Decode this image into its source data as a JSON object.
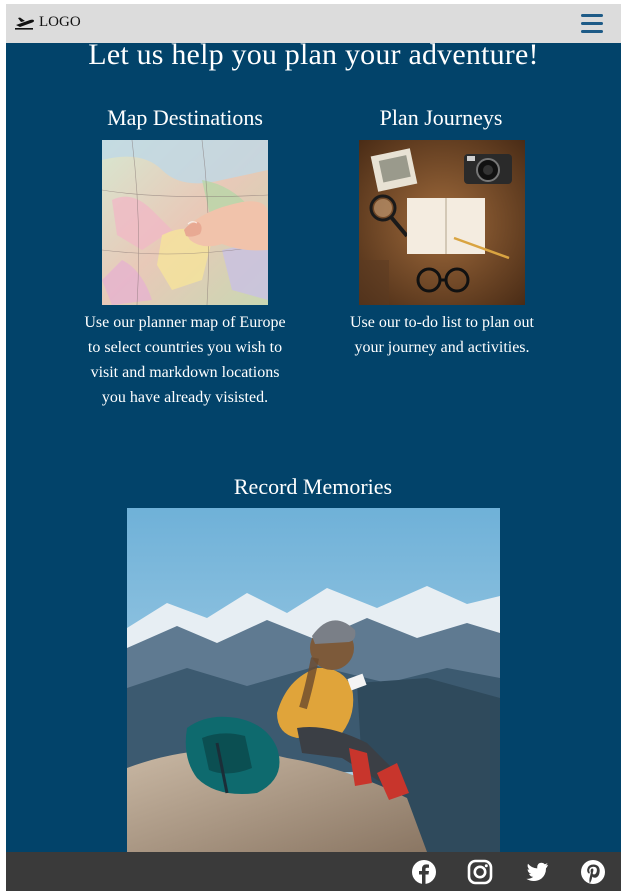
{
  "header": {
    "logo_text": "LOGO",
    "logo_icon": "plane-icon",
    "menu_icon": "hamburger-menu-icon"
  },
  "main": {
    "headline": "Let us help you plan your adventure!",
    "cards": [
      {
        "title": "Map Destinations",
        "image": "map-pointing-photo",
        "text": "Use our planner map of Europe to select countries you wish to visit and markdown locations you have already visisted."
      },
      {
        "title": "Plan Journeys",
        "image": "journal-camera-flatlay-photo",
        "text": "Use our to-do list to plan out your journey and activities."
      },
      {
        "title": "Record Memories",
        "image": "hiker-writing-on-mountain-photo",
        "text": ""
      }
    ]
  },
  "footer": {
    "social": [
      "facebook-icon",
      "instagram-icon",
      "twitter-icon",
      "pinterest-icon"
    ]
  },
  "colors": {
    "background": "#02436a",
    "header": "#dcdcdc",
    "footer": "#3a3a3a",
    "menu_accent": "#1e5b87"
  }
}
